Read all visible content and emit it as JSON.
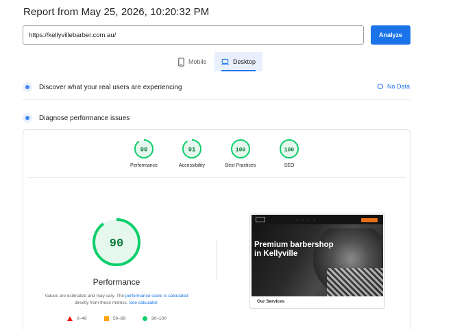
{
  "report": {
    "title": "Report from May 25, 2026, 10:20:32 PM",
    "url": "https://kellyvillebarber.com.au/",
    "analyze_label": "Analyze"
  },
  "tabs": [
    {
      "label": "Mobile",
      "icon": "phone-icon",
      "selected": false
    },
    {
      "label": "Desktop",
      "icon": "laptop-icon",
      "selected": true
    }
  ],
  "real_users": {
    "label": "Discover what your real users are experiencing",
    "status": "No Data"
  },
  "diagnose": {
    "label": "Diagnose performance issues"
  },
  "scores": [
    {
      "label": "Performance",
      "value": "90"
    },
    {
      "label": "Accessibility",
      "value": "91"
    },
    {
      "label": "Best Practices",
      "value": "100"
    },
    {
      "label": "SEO",
      "value": "100"
    }
  ],
  "performance": {
    "value": "90",
    "label": "Performance",
    "note_prefix": "Values are estimated and may vary. The ",
    "note_link": "performance score is calculated",
    "note_middle": " directly from these metrics. ",
    "note_link2": "See calculator.",
    "legend": [
      {
        "range": "0–49",
        "color": "#eb0f00"
      },
      {
        "range": "50–89",
        "color": "#ffa400"
      },
      {
        "range": "90–100",
        "color": "#0cce6b"
      }
    ]
  },
  "screenshot": {
    "hero_text": "Premium barbershop in Kellyville",
    "services_text": "Our Services"
  },
  "colors": {
    "accent": "#1a73e8",
    "good": "#0cce6b",
    "good_text": "#0d7a3a"
  }
}
